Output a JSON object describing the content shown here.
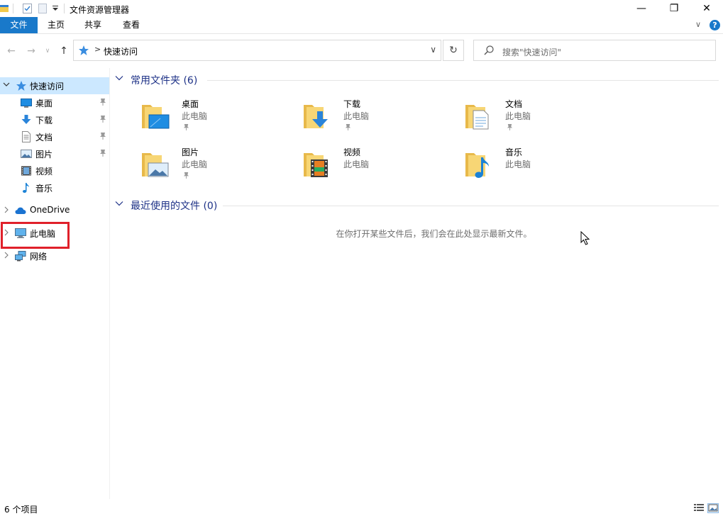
{
  "window": {
    "title": "文件资源管理器",
    "minimize_glyph": "—",
    "restore_glyph": "❐",
    "close_glyph": "✕"
  },
  "ribbon": {
    "tabs": [
      {
        "label": "文件"
      },
      {
        "label": "主页"
      },
      {
        "label": "共享"
      },
      {
        "label": "查看"
      }
    ],
    "expand_glyph": "∨",
    "help_glyph": "?"
  },
  "navigation": {
    "back_glyph": "←",
    "forward_glyph": "→",
    "recent_glyph": "∨",
    "up_glyph": "↑",
    "refresh_glyph": "↻"
  },
  "address": {
    "separator": ">",
    "path": "快速访问",
    "dropdown_glyph": "∨"
  },
  "search": {
    "placeholder": "搜索\"快速访问\""
  },
  "sidebar": {
    "items": [
      {
        "label": "快速访问",
        "icon": "star-icon"
      },
      {
        "label": "桌面",
        "icon": "desktop-icon"
      },
      {
        "label": "下载",
        "icon": "download-icon"
      },
      {
        "label": "文档",
        "icon": "document-icon"
      },
      {
        "label": "图片",
        "icon": "picture-icon"
      },
      {
        "label": "视频",
        "icon": "video-icon"
      },
      {
        "label": "音乐",
        "icon": "music-icon"
      },
      {
        "label": "OneDrive",
        "icon": "cloud-icon"
      },
      {
        "label": "此电脑",
        "icon": "computer-icon"
      },
      {
        "label": "网络",
        "icon": "network-icon"
      }
    ]
  },
  "frequent": {
    "title": "常用文件夹 (6)",
    "folders": [
      {
        "name": "桌面",
        "location": "此电脑"
      },
      {
        "name": "下载",
        "location": "此电脑"
      },
      {
        "name": "文档",
        "location": "此电脑"
      },
      {
        "name": "图片",
        "location": "此电脑"
      },
      {
        "name": "视频",
        "location": "此电脑"
      },
      {
        "name": "音乐",
        "location": "此电脑"
      }
    ]
  },
  "recent": {
    "title": "最近使用的文件 (0)",
    "empty_message": "在你打开某些文件后，我们会在此处显示最新文件。"
  },
  "status": {
    "item_count": "6 个项目"
  },
  "colors": {
    "accent": "#1979ca",
    "section_title": "#1e3287",
    "selection": "#cce8ff",
    "highlight_box": "#e0202a"
  }
}
